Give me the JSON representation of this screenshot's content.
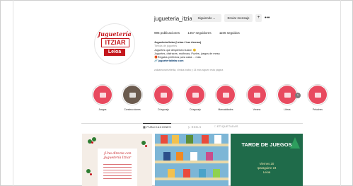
{
  "profile": {
    "username": "jugueteria_itziar",
    "follow_label": "Siguiendo ⌄",
    "message_label": "Enviar mensaje",
    "add_label": "+̲",
    "more_label": "•••",
    "logo": {
      "line1": "Juguetería",
      "line2": "ITZIAR",
      "line3": "Leioa"
    },
    "stats": {
      "posts": "996 publicaciones",
      "followers": "1457 seguidores",
      "following": "1106 seguidos"
    },
    "bio": {
      "name": "Juguetería Itziar (Leioa / Las Arenas)",
      "category": "Tienda de juguetes",
      "line1": "Juguetes que despiertan ilusión 😊",
      "line2": "Juguetes, disfraces, muñecas, Puzles, juegos de mesa",
      "line3": "🎁Regalos perfectos para cada ... más",
      "link": "🔗 jugueteriaitziar.com"
    },
    "followed_by": "zaloamunarrizbeitia, xlmica.txaba y 14 más siguen esta página"
  },
  "highlights": [
    {
      "label": "Juegos",
      "color": "#e84a5f"
    },
    {
      "label": "Construcciones",
      "color": "#6b5b4e"
    },
    {
      "label": "Di eguraju",
      "color": "#e84a5f"
    },
    {
      "label": "Di eguraju",
      "color": "#e84a5f"
    },
    {
      "label": "Manualidades",
      "color": "#e84a5f"
    },
    {
      "label": "Verano",
      "color": "#e84a5f"
    },
    {
      "label": "Libros",
      "color": "#e84a5f"
    },
    {
      "label": "Peluches",
      "color": "#e84a5f"
    }
  ],
  "tabs": {
    "posts": "▦ PUBLICACIONES",
    "reels": "▷ REELS",
    "tagged": "□ ETIQUETADAS"
  },
  "posts": {
    "p1": {
      "title_line1": "¡Una directa con",
      "title_line2": "Juguetería Itziar"
    },
    "p3": {
      "title": "TARDE DE JUEGOS",
      "line1": "Viernes 20",
      "line2": "Iparaguirre 24",
      "line3": "Leioa"
    }
  }
}
